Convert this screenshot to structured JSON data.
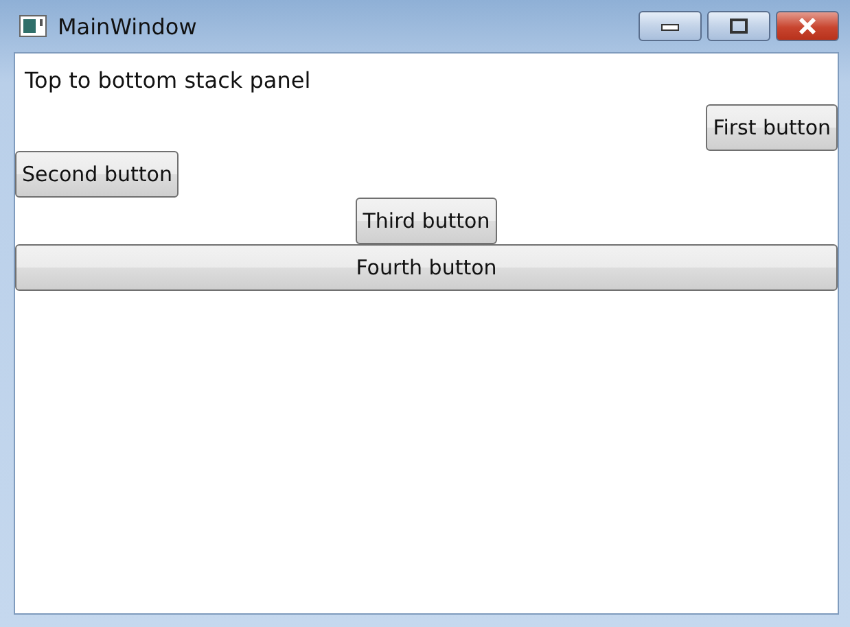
{
  "window": {
    "title": "MainWindow"
  },
  "panel": {
    "label": "Top to bottom stack panel"
  },
  "buttons": [
    {
      "label": "First button",
      "kind": "right"
    },
    {
      "label": "Second button",
      "kind": "left"
    },
    {
      "label": "Third button",
      "kind": "center"
    },
    {
      "label": "Fourth button",
      "kind": "stretch"
    }
  ]
}
